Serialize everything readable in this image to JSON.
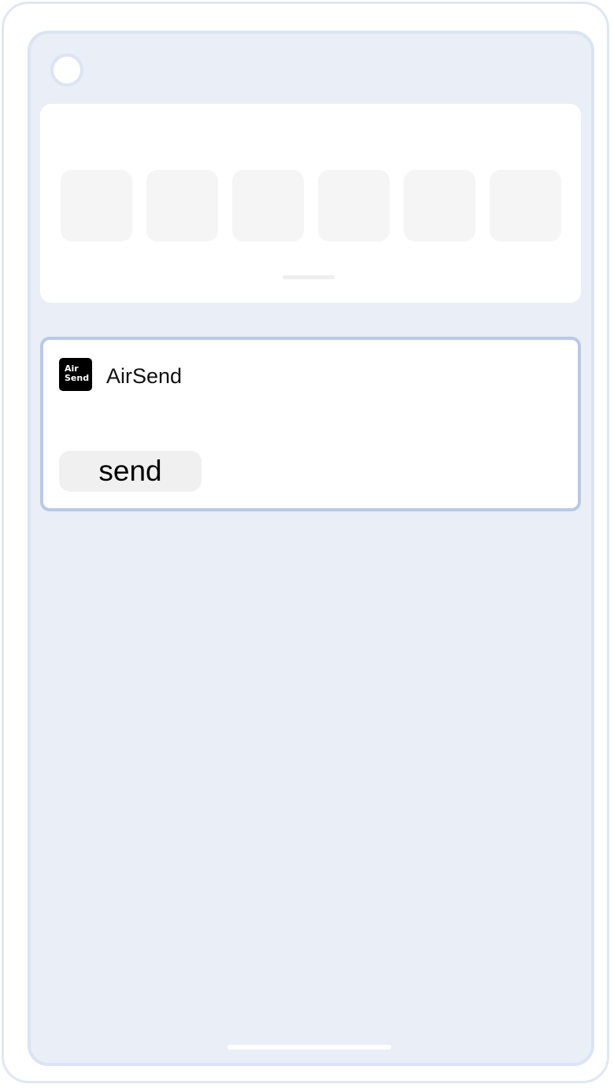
{
  "app": {
    "name": "AirSend",
    "logo_line1": "Air",
    "logo_line2": "Send",
    "send_label": "send"
  },
  "share_sheet": {
    "target_count": 6
  },
  "colors": {
    "screen_background": "#e9eef7",
    "card_border": "#b7c9e8",
    "button_background": "#f0f0f0",
    "logo_background": "#000000"
  }
}
